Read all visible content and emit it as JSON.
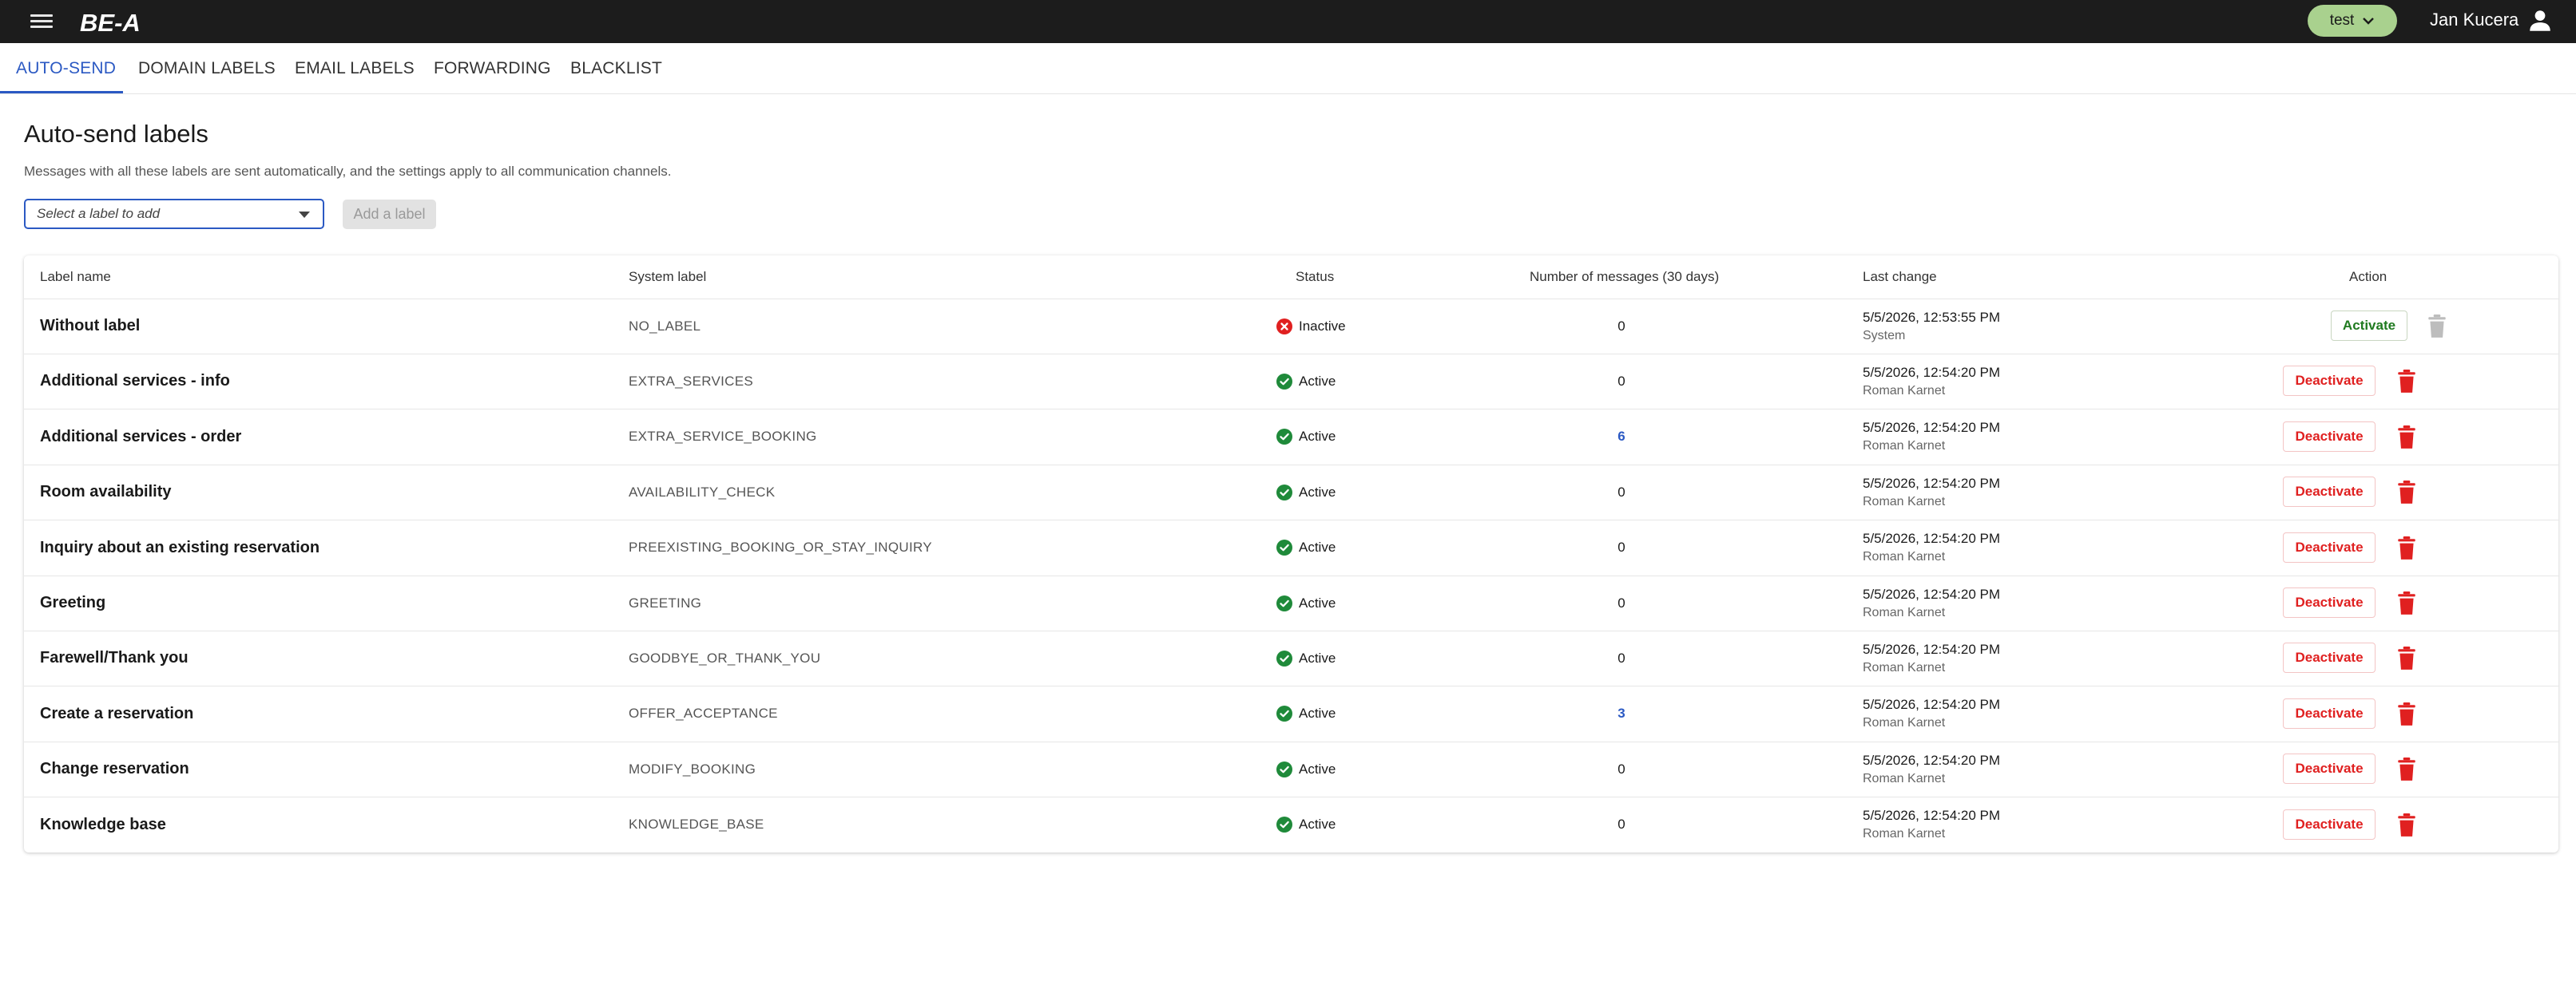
{
  "app": {
    "logo_text": "BE-A",
    "environment": "test",
    "user_name": "Jan Kucera",
    "colors": {
      "topbar": "#1c1c1c",
      "accent": "#2b59c3",
      "env_pill": "#a9d18e",
      "active": "#1f8a3a",
      "inactive": "#e02020"
    }
  },
  "tabs": [
    {
      "label": "AUTO-SEND",
      "active": true
    },
    {
      "label": "DOMAIN LABELS",
      "active": false
    },
    {
      "label": "EMAIL LABELS",
      "active": false
    },
    {
      "label": "FORWARDING",
      "active": false
    },
    {
      "label": "BLACKLIST",
      "active": false
    }
  ],
  "page": {
    "title": "Auto-send labels",
    "description": "Messages with all these labels are sent automatically, and the settings apply to all communication channels.",
    "select_placeholder": "Select a label to add",
    "add_button": "Add a label"
  },
  "table": {
    "headers": {
      "label_name": "Label name",
      "system_label": "System label",
      "status": "Status",
      "messages": "Number of messages (30 days)",
      "last_change": "Last change",
      "action": "Action"
    },
    "rows": [
      {
        "name": "Without label",
        "system": "NO_LABEL",
        "status": "Inactive",
        "count": "0",
        "count_link": false,
        "date": "5/5/2026, 12:53:55 PM",
        "user": "System",
        "action": "Activate",
        "can_delete": false
      },
      {
        "name": "Additional services - info",
        "system": "EXTRA_SERVICES",
        "status": "Active",
        "count": "0",
        "count_link": false,
        "date": "5/5/2026, 12:54:20 PM",
        "user": "Roman Karnet",
        "action": "Deactivate",
        "can_delete": true
      },
      {
        "name": "Additional services - order",
        "system": "EXTRA_SERVICE_BOOKING",
        "status": "Active",
        "count": "6",
        "count_link": true,
        "date": "5/5/2026, 12:54:20 PM",
        "user": "Roman Karnet",
        "action": "Deactivate",
        "can_delete": true
      },
      {
        "name": "Room availability",
        "system": "AVAILABILITY_CHECK",
        "status": "Active",
        "count": "0",
        "count_link": false,
        "date": "5/5/2026, 12:54:20 PM",
        "user": "Roman Karnet",
        "action": "Deactivate",
        "can_delete": true
      },
      {
        "name": "Inquiry about an existing reservation",
        "system": "PREEXISTING_BOOKING_OR_STAY_INQUIRY",
        "status": "Active",
        "count": "0",
        "count_link": false,
        "date": "5/5/2026, 12:54:20 PM",
        "user": "Roman Karnet",
        "action": "Deactivate",
        "can_delete": true
      },
      {
        "name": "Greeting",
        "system": "GREETING",
        "status": "Active",
        "count": "0",
        "count_link": false,
        "date": "5/5/2026, 12:54:20 PM",
        "user": "Roman Karnet",
        "action": "Deactivate",
        "can_delete": true
      },
      {
        "name": "Farewell/Thank you",
        "system": "GOODBYE_OR_THANK_YOU",
        "status": "Active",
        "count": "0",
        "count_link": false,
        "date": "5/5/2026, 12:54:20 PM",
        "user": "Roman Karnet",
        "action": "Deactivate",
        "can_delete": true
      },
      {
        "name": "Create a reservation",
        "system": "OFFER_ACCEPTANCE",
        "status": "Active",
        "count": "3",
        "count_link": true,
        "date": "5/5/2026, 12:54:20 PM",
        "user": "Roman Karnet",
        "action": "Deactivate",
        "can_delete": true
      },
      {
        "name": "Change reservation",
        "system": "MODIFY_BOOKING",
        "status": "Active",
        "count": "0",
        "count_link": false,
        "date": "5/5/2026, 12:54:20 PM",
        "user": "Roman Karnet",
        "action": "Deactivate",
        "can_delete": true
      },
      {
        "name": "Knowledge base",
        "system": "KNOWLEDGE_BASE",
        "status": "Active",
        "count": "0",
        "count_link": false,
        "date": "5/5/2026, 12:54:20 PM",
        "user": "Roman Karnet",
        "action": "Deactivate",
        "can_delete": true
      }
    ]
  }
}
